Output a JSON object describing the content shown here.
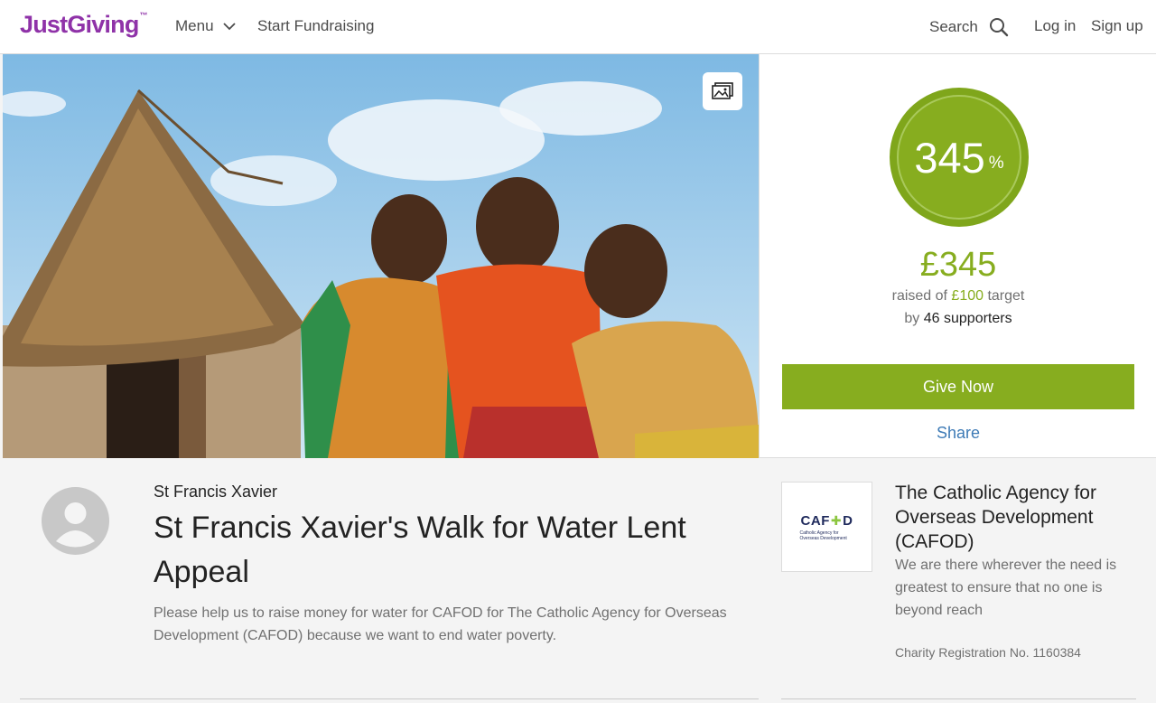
{
  "header": {
    "logo": "JustGiving",
    "menu_label": "Menu",
    "start_label": "Start Fundraising",
    "search_label": "Search",
    "login_label": "Log in",
    "signup_label": "Sign up"
  },
  "hero": {
    "icons": {
      "gallery": "image-gallery-icon"
    }
  },
  "donation": {
    "percent": "345",
    "percent_symbol": "%",
    "progress_fraction": 3.45,
    "raised": "£345",
    "raised_prefix": "raised of ",
    "target_amount": "£100",
    "target_suffix": " target",
    "by_prefix": "by ",
    "supporters": "46 supporters",
    "give_label": "Give Now",
    "share_label": "Share"
  },
  "page": {
    "owner_name": "St Francis Xavier",
    "title": "St Francis Xavier's Walk for Water Lent Appeal",
    "story": "Please help us to raise money for water for CAFOD for The Catholic Agency for Overseas Development (CAFOD) because we want to end water poverty."
  },
  "charity": {
    "logo_word_left": "CAF",
    "logo_word_right": "D",
    "logo_subtext": "Catholic Agency for Overseas Development",
    "name": "The Catholic Agency for Overseas Development (CAFOD)",
    "description": "We are there wherever the need is greatest to ensure that no one is beyond reach",
    "registration": "Charity Registration No. 1160384"
  },
  "colors": {
    "brand_purple": "#8f32a8",
    "accent_green": "#87ad1f",
    "link_blue": "#3e7bb6"
  }
}
